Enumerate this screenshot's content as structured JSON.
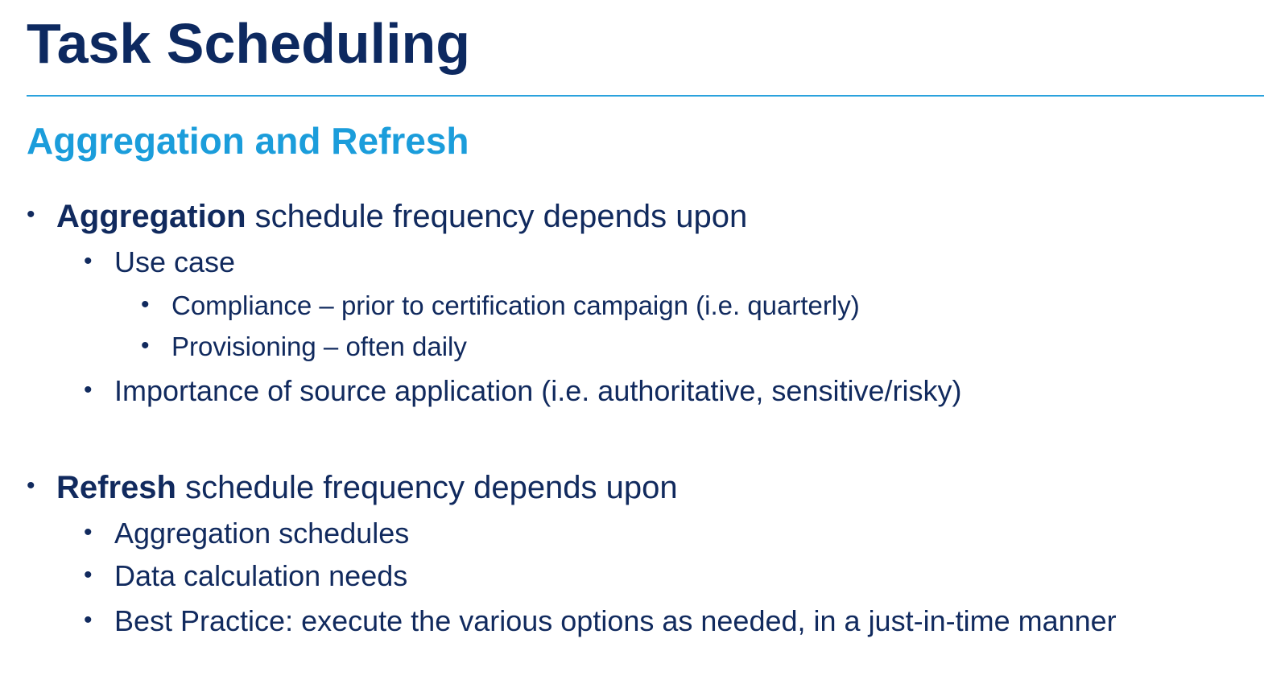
{
  "slide": {
    "title": "Task Scheduling",
    "subtitle": "Aggregation and Refresh"
  },
  "aggregation": {
    "bold": "Aggregation",
    "rest": " schedule frequency depends upon",
    "use_case": "Use case",
    "compliance": "Compliance – prior to certification campaign (i.e. quarterly)",
    "provisioning": "Provisioning – often daily",
    "importance": "Importance of source application (i.e. authoritative, sensitive/risky)"
  },
  "refresh": {
    "bold": "Refresh",
    "rest": " schedule frequency depends upon",
    "agg_schedules": "Aggregation schedules",
    "data_calc": "Data calculation needs",
    "best_practice": "Best Practice: execute the various options as needed, in a just-in-time manner"
  },
  "bullet_glyph": "•"
}
